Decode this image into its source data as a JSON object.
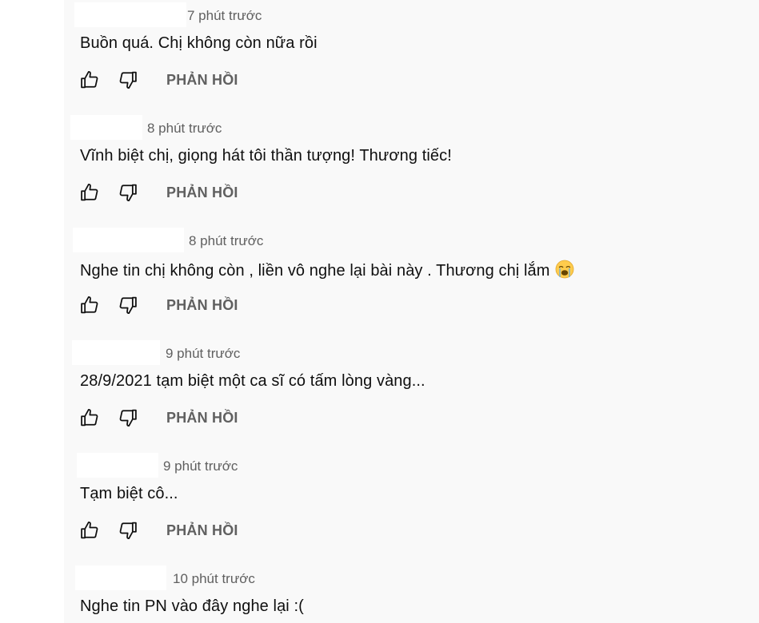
{
  "comments": [
    {
      "time": "7 phút trước",
      "text": "Buồn quá. Chị không còn nữa rồi",
      "emoji": ""
    },
    {
      "time": "8 phút trước",
      "text": "Vĩnh biệt chị, giọng hát tôi thần tượng! Thương tiếc!",
      "emoji": ""
    },
    {
      "time": "8 phút trước",
      "text": "Nghe tin chị không còn , liền vô nghe lại bài này . Thương chị lắm",
      "emoji": "crying-face-emoji"
    },
    {
      "time": "9 phút trước",
      "text": "28/9/2021 tạm biệt một ca sĩ có tấm lòng vàng...",
      "emoji": ""
    },
    {
      "time": "9 phút trước",
      "text": "Tạm biệt cô...",
      "emoji": ""
    },
    {
      "time": "10 phút trước",
      "text": "Nghe tin PN vào đây nghe lại :(",
      "emoji": ""
    }
  ],
  "actions": {
    "reply_label": "PHẢN HỒI",
    "like_icon": "thumbs-up-icon",
    "dislike_icon": "thumbs-down-icon"
  },
  "colors": {
    "panel_background": "#f9f9f9",
    "text": "#0f0f0f",
    "secondary_text": "#606060"
  }
}
